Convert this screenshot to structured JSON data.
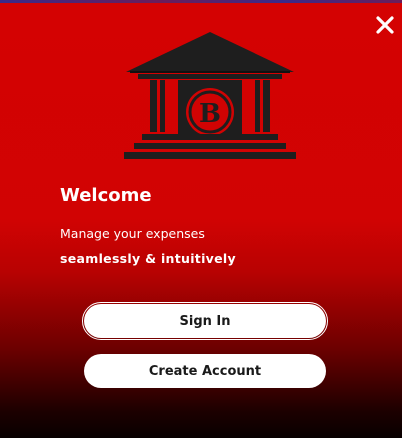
{
  "icons": {
    "close": "close-icon",
    "logo": "bank-building-logo-icon"
  },
  "logo": {
    "letter": "B"
  },
  "content": {
    "title": "Welcome",
    "tagline_line1": "Manage your expenses",
    "tagline_line2": "seamlessly & intuitively"
  },
  "actions": {
    "sign_in_label": "Sign In",
    "create_account_label": "Create Account"
  },
  "colors": {
    "background_top": "#d40202",
    "background_bottom": "#080000",
    "logo": "#1e1e1e",
    "button_bg": "#ffffff",
    "button_text": "#1a1a1a"
  }
}
